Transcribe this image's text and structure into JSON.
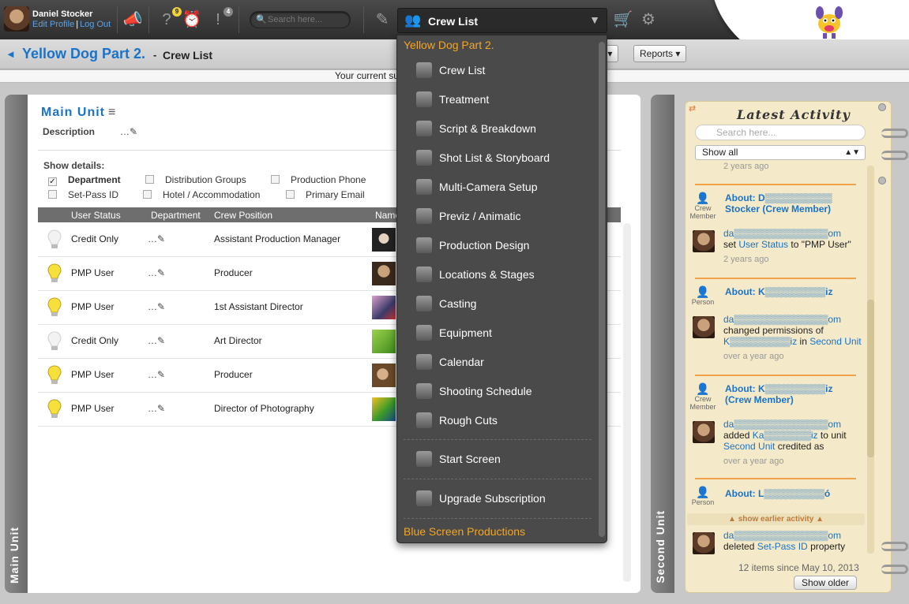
{
  "topbar": {
    "user_name": "Daniel Stocker",
    "edit_profile": "Edit Profile",
    "sep": "|",
    "log_out": "Log Out",
    "help_badge": "9",
    "notif_badge": "4",
    "search_placeholder": "Search here...",
    "section_select": "Crew List"
  },
  "breadcrumb": {
    "back_glyph": "◄",
    "project": "Yellow Dog Part 2.",
    "sep": "-",
    "page": "Crew List",
    "btn_s": "s ▾",
    "btn_reports": "Reports ▾"
  },
  "notice": "Your current su",
  "main": {
    "side_tab": "Main Unit",
    "title": "Main Unit",
    "description_label": "Description",
    "description_value": "…✎",
    "show_details_label": "Show details:",
    "details_options": [
      {
        "label": "Department",
        "checked": true
      },
      {
        "label": "Distribution Groups",
        "checked": false
      },
      {
        "label": "Production Phone",
        "checked": false
      },
      {
        "label": "Set-Pass ID",
        "checked": false
      },
      {
        "label": "Hotel / Accommodation",
        "checked": false
      },
      {
        "label": "Primary Email",
        "checked": false
      }
    ],
    "columns": [
      "User Status",
      "Department",
      "Crew Position",
      "Name"
    ],
    "rows": [
      {
        "status": "Credit Only",
        "dept": "…✎",
        "position": "Assistant Production Manager",
        "lit": false
      },
      {
        "status": "PMP User",
        "dept": "…✎",
        "position": "Producer",
        "lit": true
      },
      {
        "status": "PMP User",
        "dept": "…✎",
        "position": "1st Assistant Director",
        "lit": true
      },
      {
        "status": "Credit Only",
        "dept": "…✎",
        "position": "Art Director",
        "lit": false
      },
      {
        "status": "PMP User",
        "dept": "…✎",
        "position": "Producer",
        "lit": true
      },
      {
        "status": "PMP User",
        "dept": "…✎",
        "position": "Director of Photography",
        "lit": true
      }
    ]
  },
  "dropdown": {
    "header": "Yellow Dog Part 2.",
    "items": [
      "Crew List",
      "Treatment",
      "Script & Breakdown",
      "Shot List & Storyboard",
      "Multi-Camera Setup",
      "Previz / Animatic",
      "Production Design",
      "Locations & Stages",
      "Casting",
      "Equipment",
      "Calendar",
      "Shooting Schedule",
      "Rough Cuts"
    ],
    "start_screen": "Start Screen",
    "upgrade": "Upgrade Subscription",
    "footer": "Blue Screen Productions"
  },
  "second_unit_tab": "Second Unit",
  "activity": {
    "title": "Latest Activity",
    "search_placeholder": "Search here...",
    "filter": "Show all",
    "top_time": "2 years ago",
    "entries": [
      {
        "type": "Crew Member",
        "about": "About: D▒▒▒▒▒▒▒▒▒▒ Stocker (Crew Member)",
        "line1": "da▒▒▒▒▒▒▒▒▒▒▒▒▒▒om",
        "line2a": "set ",
        "line2link": "User Status",
        "line2b": " to \"PMP User\"",
        "time": "2 years ago"
      },
      {
        "type": "Person",
        "about": "About: K▒▒▒▒▒▒▒▒▒iz",
        "line1": "da▒▒▒▒▒▒▒▒▒▒▒▒▒▒om",
        "line2a": "changed permissions of ",
        "line2link": "K▒▒▒▒▒▒▒▒▒iz",
        "line2b": " in ",
        "line2link2": "Second Unit",
        "time": "over a year ago"
      },
      {
        "type": "Crew Member",
        "about": "About: K▒▒▒▒▒▒▒▒▒iz (Crew Member)",
        "line1": "da▒▒▒▒▒▒▒▒▒▒▒▒▒▒om",
        "line2a": "added ",
        "line2link": "Ka▒▒▒▒▒▒▒iz",
        "line2b": " to unit ",
        "line2link2": "Second Unit",
        "line2c": " credited as",
        "time": "over a year ago"
      },
      {
        "type": "Person",
        "about": "About: L▒▒▒▒▒▒▒▒▒ó"
      }
    ],
    "show_earlier": "▲  show earlier activity  ▲",
    "last_line1": "da▒▒▒▒▒▒▒▒▒▒▒▒▒▒om",
    "last_line2a": "deleted ",
    "last_line2link": "Set-Pass ID",
    "last_line2b": " property",
    "count": "12 items since May 10, 2013",
    "show_older": "Show older"
  },
  "colors": {
    "accent_blue": "#1a73c8",
    "dropdown_orange": "#f5a623",
    "bulb_yellow": "#f7e03c"
  }
}
